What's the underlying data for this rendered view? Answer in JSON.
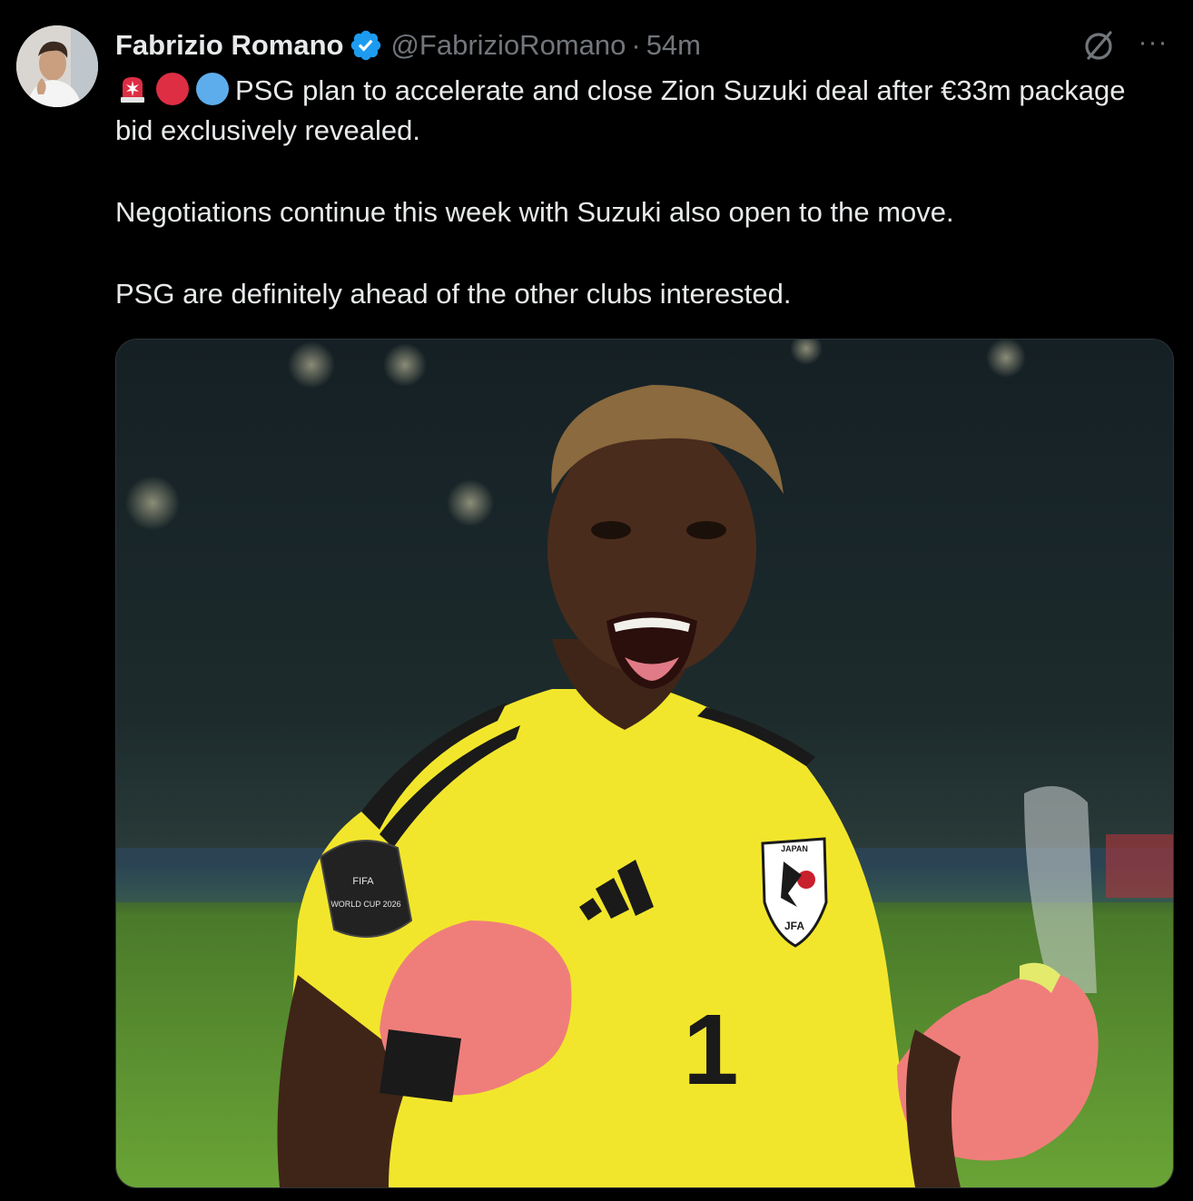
{
  "tweet": {
    "author_name": "Fabrizio Romano",
    "author_handle": "@FabrizioRomano",
    "separator": "·",
    "time": "54m",
    "more_label": "···",
    "lines": [
      "PSG plan to accelerate and close Zion Suzuki deal after €33m package bid exclusively revealed.",
      "Negotiations continue this week with Suzuki also open to the move.",
      "PSG are definitely ahead of the other clubs interested."
    ],
    "emojis": [
      "rotating-light-emoji",
      "red-circle-emoji",
      "blue-circle-emoji"
    ],
    "media": {
      "jersey_crest_text": "JAPAN",
      "jersey_crest_sub": "JFA",
      "jersey_number": "1",
      "sleeve_badge_text": "FIFA",
      "sleeve_badge_sub": "WORLD CUP 2026"
    }
  },
  "colors": {
    "background": "#000000",
    "text": "#e7e9ea",
    "muted": "#71767b",
    "verified": "#1d9bf0",
    "jersey": "#f2e62c",
    "pitch": "#5f9a2c"
  }
}
